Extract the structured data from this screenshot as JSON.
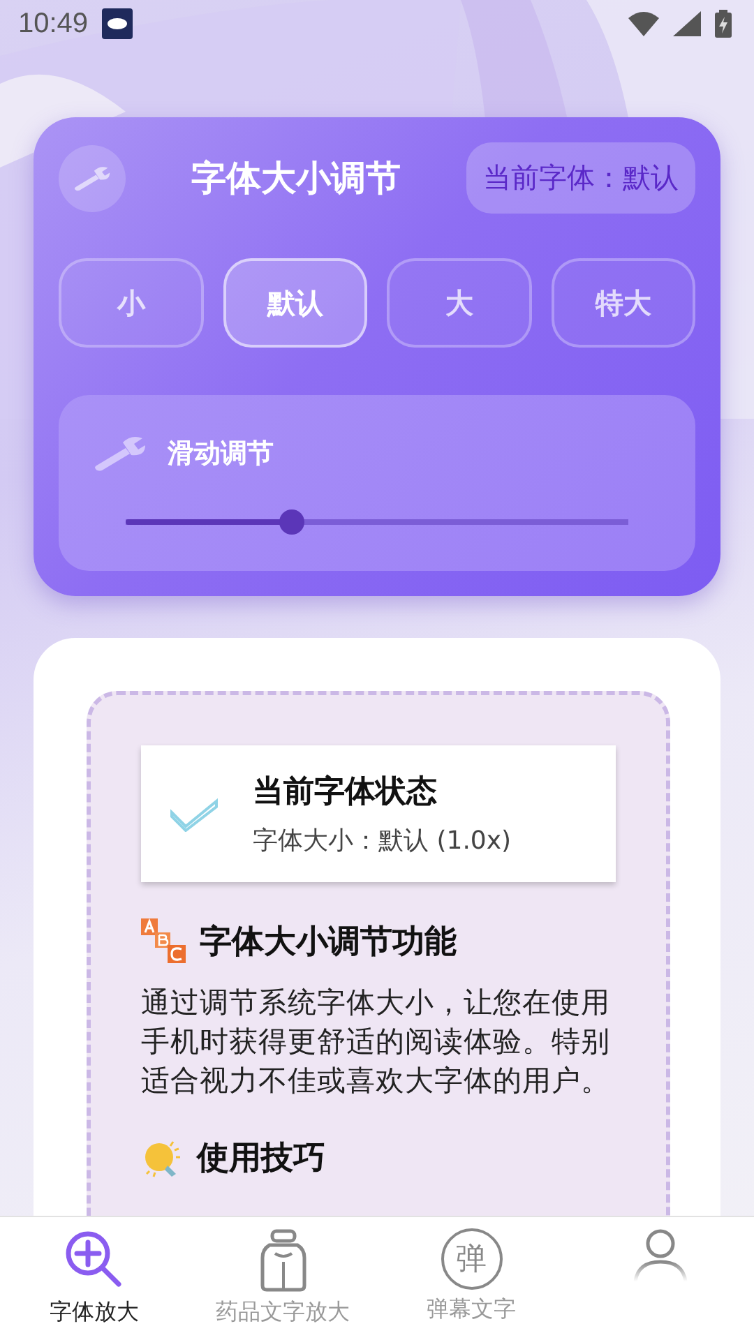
{
  "status_bar": {
    "time": "10:49"
  },
  "header": {
    "title": "字体大小调节",
    "current_badge": "当前字体：默认"
  },
  "size_options": [
    {
      "label": "小",
      "selected": false
    },
    {
      "label": "默认",
      "selected": true
    },
    {
      "label": "大",
      "selected": false
    },
    {
      "label": "特大",
      "selected": false
    }
  ],
  "slider": {
    "label": "滑动调节",
    "level": 0.33
  },
  "status_card": {
    "title": "当前字体状态",
    "detail": "字体大小：默认 (1.0x)"
  },
  "feature": {
    "title": "字体大小调节功能",
    "body": "通过调节系统字体大小，让您在使用手机时获得更舒适的阅读体验。特别适合视力不佳或喜欢大字体的用户。"
  },
  "tips": {
    "title": "使用技巧"
  },
  "bottom_nav": [
    {
      "kind": "magnifier",
      "label": "字体放大",
      "selected": true
    },
    {
      "kind": "bottle",
      "label": "药品文字放大",
      "selected": false
    },
    {
      "kind": "glyph",
      "glyph": "弹",
      "label": "弹幕文字",
      "selected": false
    },
    {
      "kind": "person",
      "selected": false
    }
  ]
}
